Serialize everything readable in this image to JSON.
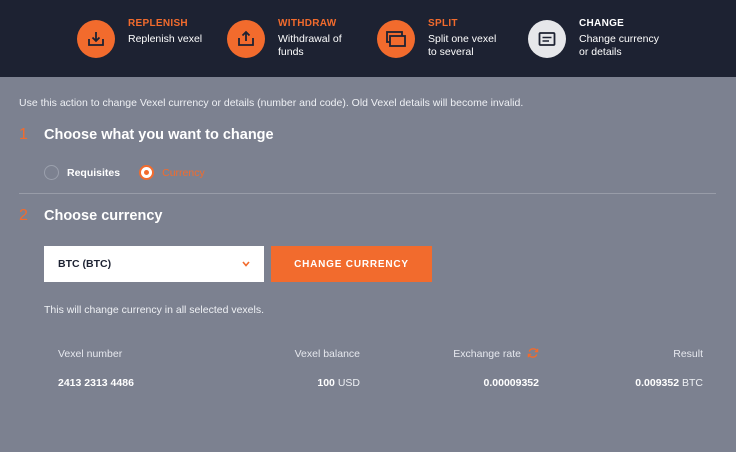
{
  "actions": [
    {
      "title": "REPLENISH",
      "desc": [
        "Replenish vexel"
      ],
      "icon": "download-tray-icon"
    },
    {
      "title": "WITHDRAW",
      "desc": [
        "Withdrawal of",
        "funds"
      ],
      "icon": "upload-tray-icon"
    },
    {
      "title": "SPLIT",
      "desc": [
        "Split one vexel",
        "to several"
      ],
      "icon": "split-cards-icon"
    },
    {
      "title": "CHANGE",
      "desc": [
        "Change currency",
        "or details"
      ],
      "icon": "card-icon"
    }
  ],
  "info_text": "Use this action to change Vexel currency or details (number and code). Old Vexel details will become invalid.",
  "step1": {
    "number": "1",
    "title": "Choose what you want to change"
  },
  "radios": [
    {
      "label": "Requisites",
      "selected": false
    },
    {
      "label": "Currency",
      "selected": true
    }
  ],
  "step2": {
    "number": "2",
    "title": "Choose currency"
  },
  "currency_select": {
    "value": "BTC (BTC)"
  },
  "change_button": {
    "label": "CHANGE CURRENCY"
  },
  "note": "This will change currency in all selected vexels.",
  "table": {
    "headers": [
      "Vexel number",
      "Vexel balance",
      "Exchange rate",
      "Result"
    ],
    "row": {
      "vexel_number": "2413 2313 4486",
      "balance": "100",
      "balance_unit": "USD",
      "rate": "0.00009352",
      "result": "0.009352",
      "result_unit": "BTC"
    }
  },
  "colors": {
    "accent": "#f26b2d",
    "header_bg": "#1d2232",
    "page_bg": "#7c8190"
  }
}
